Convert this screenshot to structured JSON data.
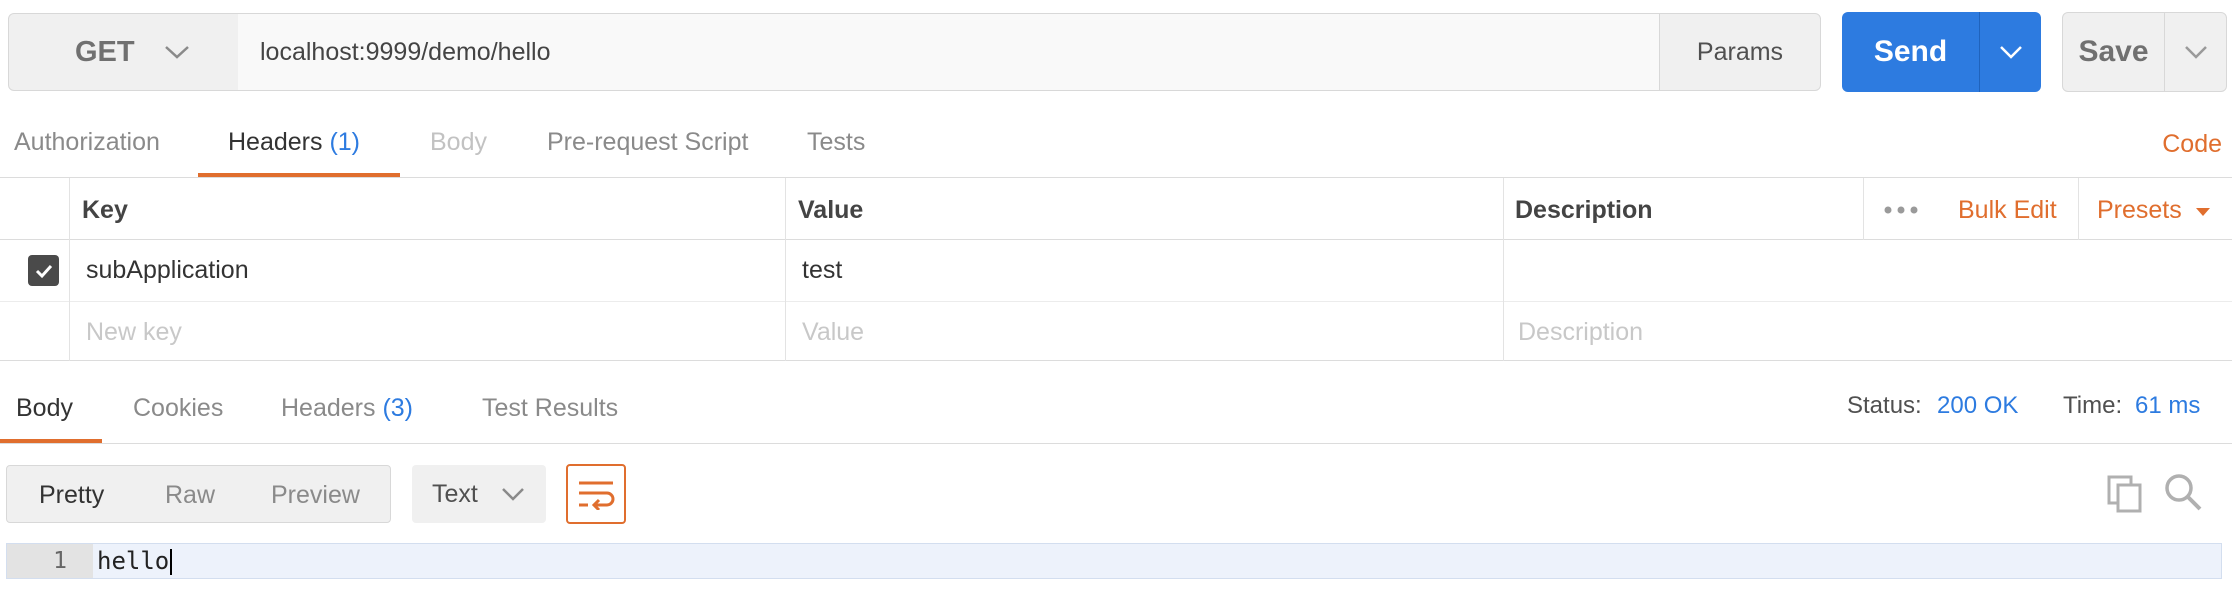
{
  "request": {
    "method": "GET",
    "url": "localhost:9999/demo/hello",
    "params_label": "Params",
    "send_label": "Send",
    "save_label": "Save"
  },
  "request_tabs": {
    "authorization": "Authorization",
    "headers": "Headers",
    "headers_count": "(1)",
    "body": "Body",
    "prerequest": "Pre-request Script",
    "tests": "Tests",
    "code": "Code"
  },
  "headers_table": {
    "columns": {
      "key": "Key",
      "value": "Value",
      "description": "Description"
    },
    "bulk_edit": "Bulk Edit",
    "presets": "Presets",
    "rows": [
      {
        "checked": true,
        "key": "subApplication",
        "value": "test",
        "description": ""
      }
    ],
    "placeholders": {
      "key": "New key",
      "value": "Value",
      "description": "Description"
    }
  },
  "response_tabs": {
    "body": "Body",
    "cookies": "Cookies",
    "headers": "Headers",
    "headers_count": "(3)",
    "test_results": "Test Results",
    "status_label": "Status:",
    "status_value": "200 OK",
    "time_label": "Time:",
    "time_value": "61 ms"
  },
  "response_view": {
    "modes": [
      "Pretty",
      "Raw",
      "Preview"
    ],
    "selected_mode": "Pretty",
    "format": "Text",
    "lines": [
      {
        "number": "1",
        "text": "hello"
      }
    ]
  },
  "colors": {
    "accent_orange": "#e06e2e",
    "send_blue": "#2d7be0",
    "count_blue": "#2d7be0"
  }
}
